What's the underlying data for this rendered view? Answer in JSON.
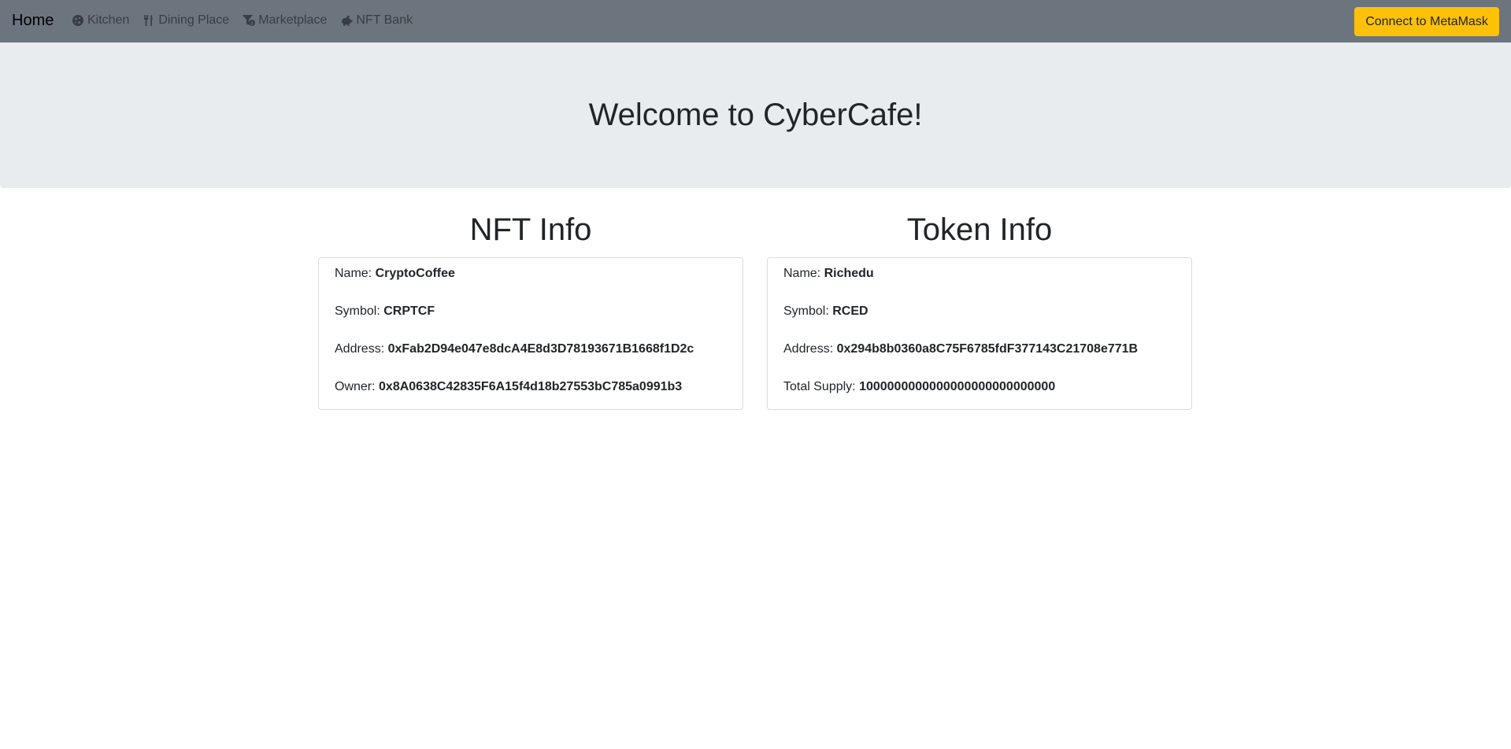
{
  "nav": {
    "brand": "Home",
    "links": [
      {
        "label": "Kitchen",
        "icon": "cookie-icon"
      },
      {
        "label": "Dining Place",
        "icon": "utensils-icon"
      },
      {
        "label": "Marketplace",
        "icon": "funnel-dollar-icon"
      },
      {
        "label": "NFT Bank",
        "icon": "piggy-bank-icon"
      }
    ],
    "connect_label": "Connect to MetaMask"
  },
  "hero": {
    "title": "Welcome to CyberCafe!"
  },
  "nft": {
    "heading": "NFT Info",
    "rows": [
      {
        "label": "Name:",
        "value": "CryptoCoffee"
      },
      {
        "label": "Symbol:",
        "value": "CRPTCF"
      },
      {
        "label": "Address:",
        "value": "0xFab2D94e047e8dcA4E8d3D78193671B1668f1D2c"
      },
      {
        "label": "Owner:",
        "value": "0x8A0638C42835F6A15f4d18b27553bC785a0991b3"
      }
    ]
  },
  "token": {
    "heading": "Token Info",
    "rows": [
      {
        "label": "Name:",
        "value": "Richedu"
      },
      {
        "label": "Symbol:",
        "value": "RCED"
      },
      {
        "label": "Address:",
        "value": "0x294b8b0360a8C75F6785fdF377143C21708e771B"
      },
      {
        "label": "Total Supply:",
        "value": "1000000000000000000000000000"
      }
    ]
  },
  "colors": {
    "navbar": "#6c757d",
    "jumbotron": "#e9ecef",
    "button": "#ffc107"
  }
}
